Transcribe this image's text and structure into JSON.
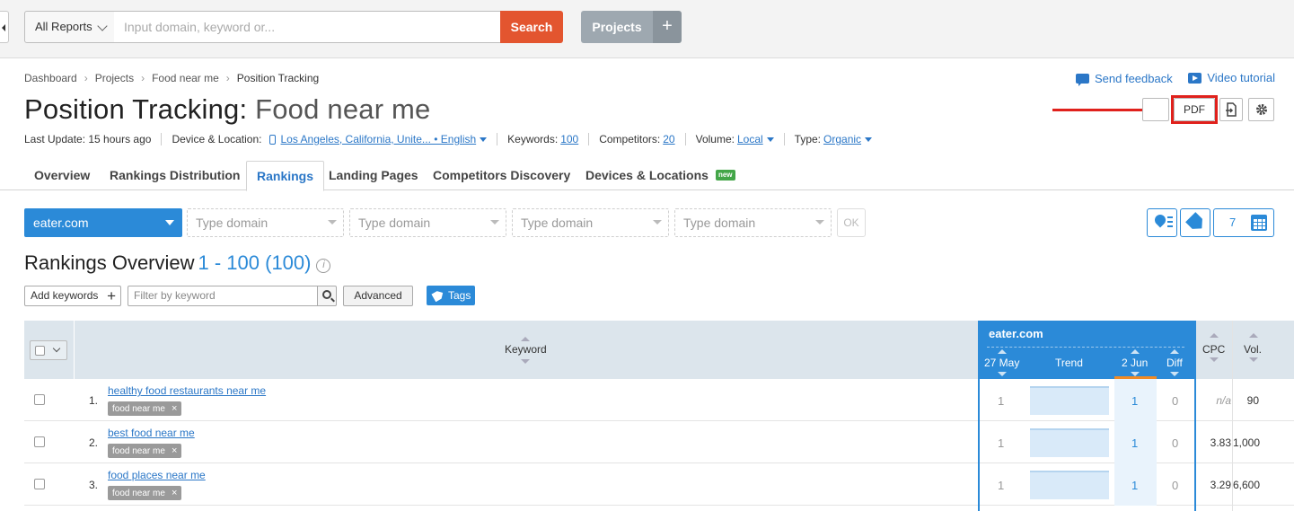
{
  "topbar": {
    "reports_label": "All Reports",
    "search_placeholder": "Input domain, keyword or...",
    "search_button": "Search",
    "projects_button": "Projects",
    "projects_plus": "+"
  },
  "breadcrumb": [
    "Dashboard",
    "Projects",
    "Food near me",
    "Position Tracking"
  ],
  "top_links": {
    "feedback": "Send feedback",
    "video": "Video tutorial"
  },
  "title": {
    "tool": "Position Tracking:",
    "project": "Food near me"
  },
  "title_buttons": {
    "pdf": "PDF"
  },
  "meta": {
    "last_update": "Last Update: 15 hours ago",
    "device_location_label": "Device & Location:",
    "device_location_value": "Los Angeles, California, Unite... • English",
    "keywords_label": "Keywords:",
    "keywords_value": "100",
    "competitors_label": "Competitors:",
    "competitors_value": "20",
    "volume_label": "Volume:",
    "volume_value": "Local",
    "type_label": "Type:",
    "type_value": "Organic"
  },
  "tabs": [
    {
      "label": "Overview"
    },
    {
      "label": "Rankings Distribution"
    },
    {
      "label": "Rankings"
    },
    {
      "label": "Landing Pages"
    },
    {
      "label": "Competitors Discovery"
    },
    {
      "label": "Devices & Locations"
    }
  ],
  "new_badge": "new",
  "domains": {
    "main": "eater.com",
    "placeholder": "Type domain",
    "ok": "OK",
    "period": "7"
  },
  "rankings": {
    "title": "Rankings Overview",
    "range": "1 - 100 (100)",
    "info": "i",
    "add_keywords": "Add keywords",
    "add_plus": "+",
    "filter_placeholder": "Filter by keyword",
    "advanced": "Advanced",
    "tags": "Tags"
  },
  "table": {
    "keyword_header": "Keyword",
    "domain_header": "eater.com",
    "col_27may": "27 May",
    "col_trend": "Trend",
    "col_2jun": "2 Jun",
    "col_diff": "Diff",
    "col_cpc": "CPC",
    "col_vol": "Vol.",
    "rows": [
      {
        "num": "1.",
        "keyword": "healthy food restaurants near me",
        "tag": "food near me",
        "v27": "1",
        "v2": "1",
        "diff": "0",
        "cpc": "n/a",
        "vol": "90"
      },
      {
        "num": "2.",
        "keyword": "best food near me",
        "tag": "food near me",
        "v27": "1",
        "v2": "1",
        "diff": "0",
        "cpc": "3.83",
        "vol": "1,000"
      },
      {
        "num": "3.",
        "keyword": "food places near me",
        "tag": "food near me",
        "v27": "1",
        "v2": "1",
        "diff": "0",
        "cpc": "3.29",
        "vol": "6,600"
      }
    ]
  },
  "colors": {
    "accent_blue": "#2b8ad8",
    "search_orange": "#e3552f",
    "highlight_red": "#e0211c"
  }
}
